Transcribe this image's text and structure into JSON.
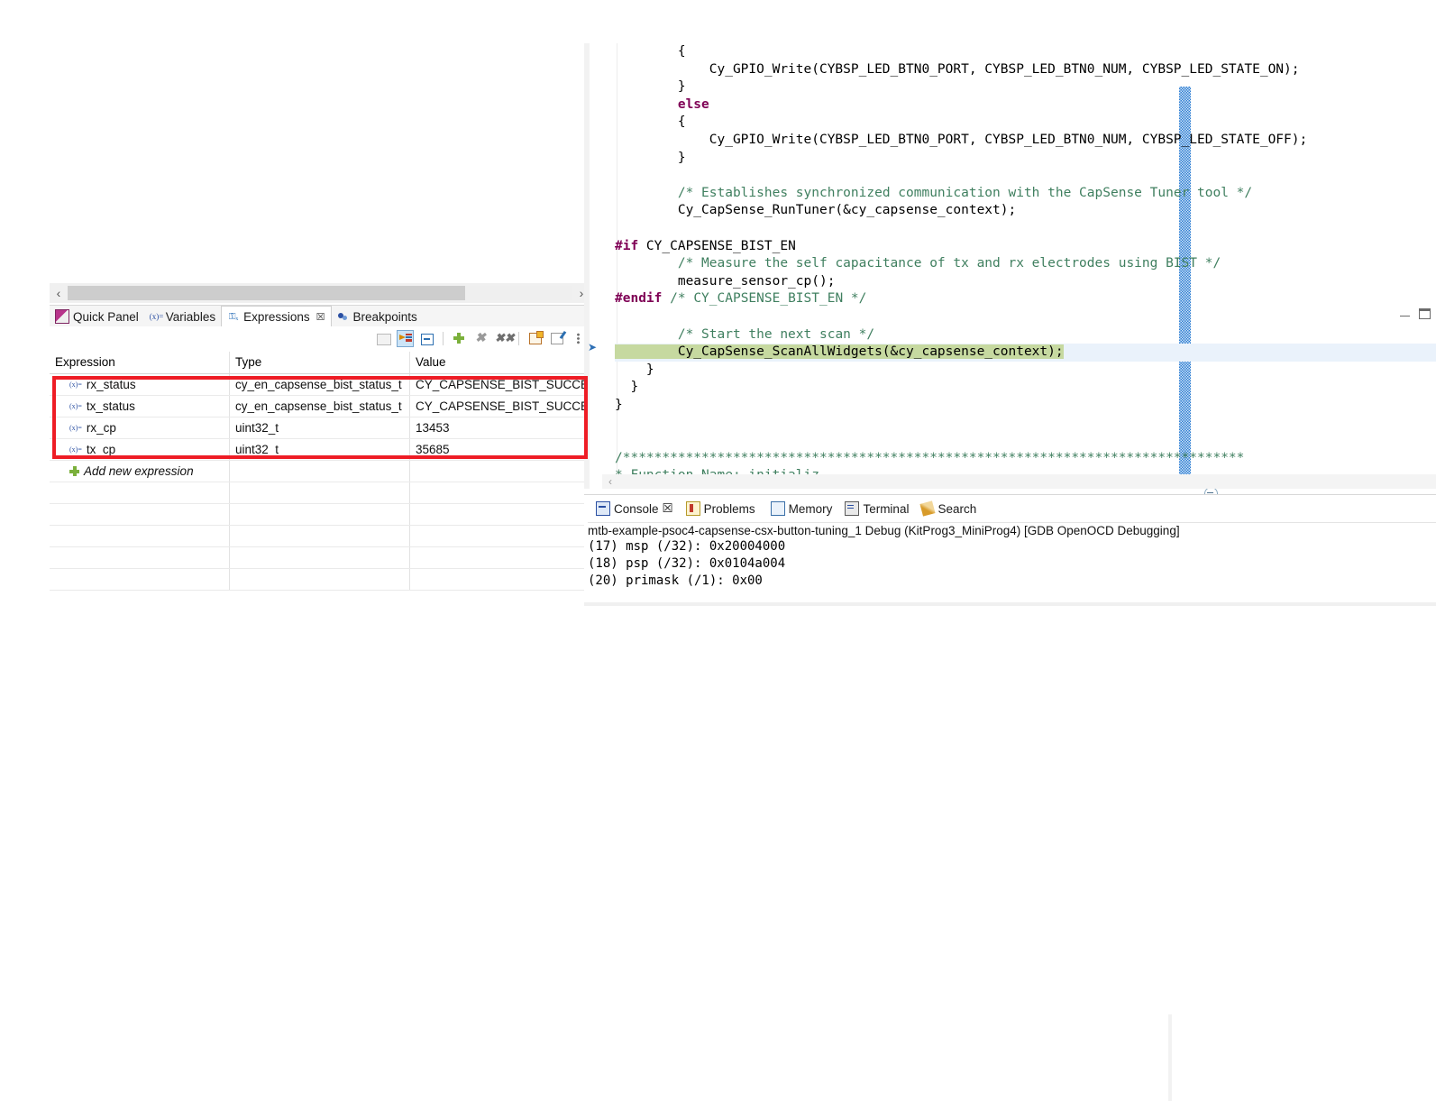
{
  "expressions_view": {
    "scrollbar": {
      "left_arrow": "‹",
      "right_arrow": "›"
    },
    "tabs": [
      {
        "label": "Quick Panel",
        "icon": "quick-panel-icon",
        "active": false
      },
      {
        "label": "Variables",
        "icon": "variables-icon",
        "active": false
      },
      {
        "label": "Expressions",
        "icon": "expressions-icon",
        "active": true,
        "close": "☒"
      },
      {
        "label": "Breakpoints",
        "icon": "breakpoints-icon",
        "active": false
      }
    ],
    "window_controls": {
      "minimize": "minimize-icon",
      "maximize": "maximize-icon"
    },
    "toolbar": [
      {
        "name": "paste-expressions-button",
        "label": "",
        "enabled": false
      },
      {
        "name": "show-type-names-button",
        "label": "",
        "selected": true
      },
      {
        "name": "collapse-all-button",
        "label": ""
      },
      {
        "name": "add-new-expression-button",
        "label": ""
      },
      {
        "name": "remove-selected-expressions-button",
        "label": ""
      },
      {
        "name": "remove-all-expressions-button",
        "label": ""
      },
      {
        "name": "new-watchlist-button",
        "label": ""
      },
      {
        "name": "edit-watch-expression-button",
        "label": ""
      },
      {
        "name": "view-menu-button",
        "label": ""
      }
    ],
    "columns": [
      "Expression",
      "Type",
      "Value"
    ],
    "rows": [
      {
        "expression": "rx_status",
        "type": "cy_en_capsense_bist_status_t",
        "value": "CY_CAPSENSE_BIST_SUCCE…"
      },
      {
        "expression": "tx_status",
        "type": "cy_en_capsense_bist_status_t",
        "value": "CY_CAPSENSE_BIST_SUCCE…"
      },
      {
        "expression": "rx_cp",
        "type": "uint32_t",
        "value": "13453"
      },
      {
        "expression": "tx_cp",
        "type": "uint32_t",
        "value": "35685"
      }
    ],
    "add_new_expression_label": "Add new expression",
    "variable_icon_glyph": "(x)=",
    "highlight_rect_color": "#ee1c25"
  },
  "editor": {
    "lines": [
      {
        "indent": 0,
        "segments": [
          {
            "t": "        {",
            "c": "plain"
          }
        ]
      },
      {
        "indent": 0,
        "segments": [
          {
            "t": "            Cy_GPIO_Write(CYBSP_LED_BTN0_PORT, CYBSP_LED_BTN0_NUM, CYBSP_LED_STATE_ON);",
            "c": "plain"
          }
        ]
      },
      {
        "indent": 0,
        "segments": [
          {
            "t": "        }",
            "c": "plain"
          }
        ]
      },
      {
        "indent": 0,
        "segments": [
          {
            "t": "        ",
            "c": "plain"
          },
          {
            "t": "else",
            "c": "kw"
          }
        ]
      },
      {
        "indent": 0,
        "segments": [
          {
            "t": "        {",
            "c": "plain"
          }
        ]
      },
      {
        "indent": 0,
        "segments": [
          {
            "t": "            Cy_GPIO_Write(CYBSP_LED_BTN0_PORT, CYBSP_LED_BTN0_NUM, CYBSP_LED_STATE_OFF);",
            "c": "plain"
          }
        ]
      },
      {
        "indent": 0,
        "segments": [
          {
            "t": "        }",
            "c": "plain"
          }
        ]
      },
      {
        "indent": 0,
        "segments": [
          {
            "t": "",
            "c": "plain"
          }
        ]
      },
      {
        "indent": 0,
        "segments": [
          {
            "t": "        ",
            "c": "plain"
          },
          {
            "t": "/* Establishes synchronized communication with the CapSense Tuner tool */",
            "c": "cmt"
          }
        ]
      },
      {
        "indent": 0,
        "segments": [
          {
            "t": "        Cy_CapSense_RunTuner(&cy_capsense_context);",
            "c": "plain"
          }
        ]
      },
      {
        "indent": 0,
        "segments": [
          {
            "t": "",
            "c": "plain"
          }
        ]
      },
      {
        "indent": 0,
        "segments": [
          {
            "t": "#if",
            "c": "pp"
          },
          {
            "t": " CY_CAPSENSE_BIST_EN",
            "c": "plain"
          }
        ]
      },
      {
        "indent": 0,
        "segments": [
          {
            "t": "        ",
            "c": "plain"
          },
          {
            "t": "/* Measure the self capacitance of tx and rx electrodes using BIST */",
            "c": "cmt"
          }
        ]
      },
      {
        "indent": 0,
        "segments": [
          {
            "t": "        measure_sensor_cp();",
            "c": "plain"
          }
        ]
      },
      {
        "indent": 0,
        "segments": [
          {
            "t": "#endif",
            "c": "pp"
          },
          {
            "t": " ",
            "c": "plain"
          },
          {
            "t": "/* CY_CAPSENSE_BIST_EN */",
            "c": "cmt"
          }
        ]
      },
      {
        "indent": 0,
        "segments": [
          {
            "t": "",
            "c": "plain"
          }
        ]
      },
      {
        "indent": 0,
        "segments": [
          {
            "t": "        ",
            "c": "plain"
          },
          {
            "t": "/* Start the next scan */",
            "c": "cmt"
          }
        ]
      },
      {
        "indent": 0,
        "highlight": "green",
        "segments": [
          {
            "t": "        Cy_CapSense_ScanAllWidgets(&cy_capsense_context);",
            "c": "plain"
          }
        ]
      },
      {
        "indent": 0,
        "segments": [
          {
            "t": "    }",
            "c": "plain"
          }
        ]
      },
      {
        "indent": 0,
        "segments": [
          {
            "t": "  }",
            "c": "plain"
          }
        ]
      },
      {
        "indent": 0,
        "segments": [
          {
            "t": "}",
            "c": "plain"
          }
        ]
      },
      {
        "indent": 0,
        "segments": [
          {
            "t": "",
            "c": "plain"
          }
        ]
      },
      {
        "indent": 0,
        "segments": [
          {
            "t": "",
            "c": "plain"
          }
        ]
      },
      {
        "indent": 0,
        "segments": [
          {
            "t": "/*******************************************************************************",
            "c": "cmt"
          }
        ]
      },
      {
        "indent": 0,
        "segments": [
          {
            "t": "* Function Name: initializ",
            "c": "cmt"
          }
        ]
      }
    ],
    "highlight_colors": {
      "executing_line": "#c6d9a0",
      "current_line": "#eaf2fb"
    },
    "hscroll_left_arrow": "‹"
  },
  "console_view": {
    "tabs": [
      {
        "label": "Console",
        "icon": "console-icon",
        "active": true,
        "close": "☒"
      },
      {
        "label": "Problems",
        "icon": "problems-icon",
        "active": false
      },
      {
        "label": "Memory",
        "icon": "memory-icon",
        "active": false
      },
      {
        "label": "Terminal",
        "icon": "terminal-icon",
        "active": false
      },
      {
        "label": "Search",
        "icon": "search-icon",
        "active": false
      }
    ],
    "title": "mtb-example-psoc4-capsense-csx-button-tuning_1 Debug (KitProg3_MiniProg4) [GDB OpenOCD Debugging]",
    "output_lines": [
      "(17) msp (/32): 0x20004000",
      "(18) psp (/32): 0x0104a004",
      "(20) primask (/1): 0x00"
    ]
  }
}
